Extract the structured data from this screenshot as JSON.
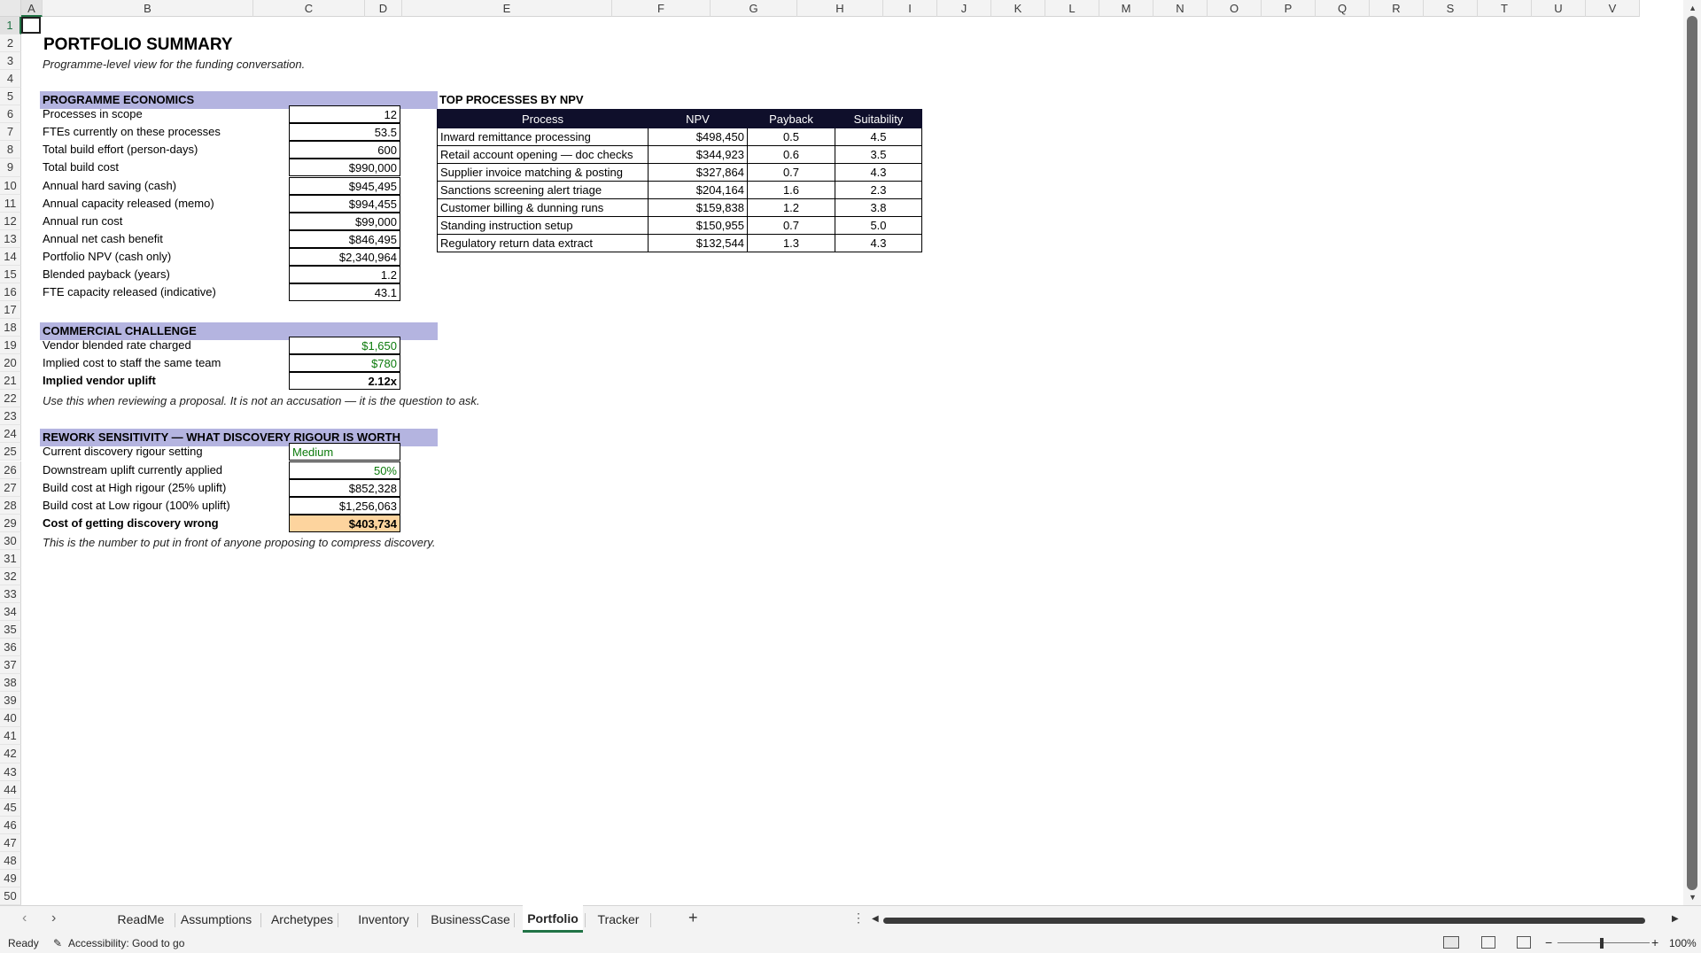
{
  "columns": [
    "A",
    "B",
    "C",
    "D",
    "E",
    "F",
    "G",
    "H",
    "I",
    "J",
    "K",
    "L",
    "M",
    "N",
    "O",
    "P",
    "Q",
    "R",
    "S",
    "T",
    "U",
    "V"
  ],
  "rows": [
    "1",
    "2",
    "3",
    "4",
    "5",
    "6",
    "7",
    "8",
    "9",
    "10",
    "11",
    "12",
    "13",
    "14",
    "15",
    "16",
    "17",
    "18",
    "19",
    "20",
    "21",
    "22",
    "23",
    "24",
    "25",
    "26",
    "27",
    "28",
    "29",
    "30",
    "31",
    "32",
    "33",
    "34",
    "35",
    "36",
    "37",
    "38",
    "39",
    "40",
    "41",
    "42",
    "43",
    "44",
    "45",
    "46",
    "47",
    "48",
    "49",
    "50"
  ],
  "sheet": {
    "title": "PORTFOLIO SUMMARY",
    "subtitle": "Programme-level view for the funding conversation.",
    "economics": {
      "header": "PROGRAMME ECONOMICS",
      "items": [
        {
          "label": "Processes in scope",
          "value": "12"
        },
        {
          "label": "FTEs currently on these processes",
          "value": "53.5"
        },
        {
          "label": "Total build effort (person-days)",
          "value": "600"
        },
        {
          "label": "Total build cost",
          "value": "$990,000"
        },
        {
          "label": "Annual hard saving (cash)",
          "value": "$945,495"
        },
        {
          "label": "Annual capacity released (memo)",
          "value": "$994,455"
        },
        {
          "label": "Annual run cost",
          "value": "$99,000"
        },
        {
          "label": "Annual net cash benefit",
          "value": "$846,495"
        },
        {
          "label": "Portfolio NPV (cash only)",
          "value": "$2,340,964"
        },
        {
          "label": "Blended payback (years)",
          "value": "1.2"
        },
        {
          "label": "FTE capacity released (indicative)",
          "value": "43.1"
        }
      ]
    },
    "top_processes": {
      "header": "TOP PROCESSES BY NPV",
      "columns": [
        "Process",
        "NPV",
        "Payback",
        "Suitability"
      ],
      "rows": [
        [
          "Inward remittance processing",
          "$498,450",
          "0.5",
          "4.5"
        ],
        [
          "Retail account opening — doc checks",
          "$344,923",
          "0.6",
          "3.5"
        ],
        [
          "Supplier invoice matching & posting",
          "$327,864",
          "0.7",
          "4.3"
        ],
        [
          "Sanctions screening alert triage",
          "$204,164",
          "1.6",
          "2.3"
        ],
        [
          "Customer billing & dunning runs",
          "$159,838",
          "1.2",
          "3.8"
        ],
        [
          "Standing instruction setup",
          "$150,955",
          "0.7",
          "5.0"
        ],
        [
          "Regulatory return data extract",
          "$132,544",
          "1.3",
          "4.3"
        ]
      ]
    },
    "commercial": {
      "header": "COMMERCIAL CHALLENGE",
      "items": [
        {
          "label": "Vendor blended rate charged",
          "value": "$1,650"
        },
        {
          "label": "Implied cost to staff the same team",
          "value": "$780"
        },
        {
          "label": "Implied vendor uplift",
          "value": "2.12x"
        }
      ],
      "note": "Use this when reviewing a proposal. It is not an accusation — it is the question to ask."
    },
    "rework": {
      "header": "REWORK SENSITIVITY — WHAT DISCOVERY RIGOUR IS WORTH",
      "items": [
        {
          "label": "Current discovery rigour setting",
          "value": "Medium"
        },
        {
          "label": "Downstream uplift currently applied",
          "value": "50%"
        },
        {
          "label": "Build cost at High rigour (25% uplift)",
          "value": "$852,328"
        },
        {
          "label": "Build cost at Low rigour (100% uplift)",
          "value": "$1,256,063"
        },
        {
          "label": "Cost of getting discovery wrong",
          "value": "$403,734"
        }
      ],
      "note": "This is the number to put in front of anyone proposing to compress discovery."
    }
  },
  "tabs": [
    "ReadMe",
    "Assumptions",
    "Archetypes",
    "Inventory",
    "BusinessCase",
    "Portfolio",
    "Tracker"
  ],
  "active_tab": "Portfolio",
  "status": {
    "ready": "Ready",
    "accessibility": "Accessibility: Good to go",
    "zoom": "100%"
  },
  "colors": {
    "section_fill": "#b4b4e0",
    "table_header_fill": "#0f0f2b",
    "input_green": "#0b7a0b",
    "highlight_orange": "#fdd49e",
    "excel_green": "#217346"
  }
}
